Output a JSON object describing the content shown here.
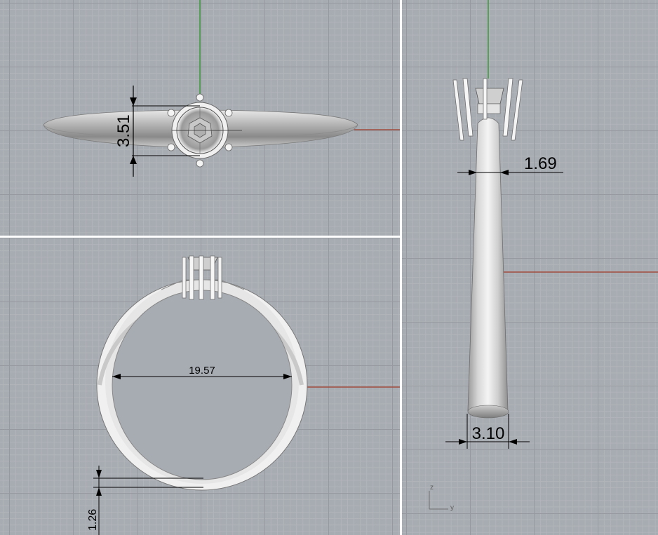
{
  "views": {
    "top": {
      "dimension": "3.51"
    },
    "front": {
      "inner_diameter": "19.57",
      "band_thickness": "1.26"
    },
    "right": {
      "top_width": "1.69",
      "bottom_width": "3.10",
      "axis_labels": {
        "vertical": "z",
        "horizontal": "y"
      }
    }
  },
  "colors": {
    "viewport_bg": "#a7acb2",
    "grid_major": "#96999f",
    "grid_minor": "#b1b5ba",
    "x_axis": "#a04b3c",
    "y_axis": "#3c9a3c",
    "divider": "#ffffff"
  }
}
